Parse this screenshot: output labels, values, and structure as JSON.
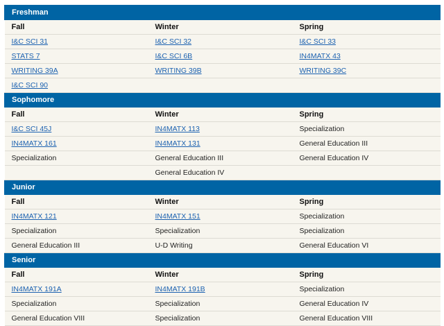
{
  "columns": [
    "Fall",
    "Winter",
    "Spring"
  ],
  "years": [
    {
      "name": "Freshman",
      "rows": [
        [
          {
            "text": "I&C SCI 31",
            "link": true
          },
          {
            "text": "I&C SCI 32",
            "link": true
          },
          {
            "text": "I&C SCI 33",
            "link": true
          }
        ],
        [
          {
            "text": "STATS 7",
            "link": true
          },
          {
            "text": "I&C SCI 6B",
            "link": true
          },
          {
            "text": "IN4MATX 43",
            "link": true
          }
        ],
        [
          {
            "text": "WRITING 39A",
            "link": true
          },
          {
            "text": "WRITING 39B",
            "link": true
          },
          {
            "text": "WRITING 39C",
            "link": true
          }
        ],
        [
          {
            "text": "I&C SCI 90",
            "link": true
          },
          {
            "text": "",
            "link": false
          },
          {
            "text": "",
            "link": false
          }
        ]
      ]
    },
    {
      "name": "Sophomore",
      "rows": [
        [
          {
            "text": "I&C SCI 45J",
            "link": true
          },
          {
            "text": "IN4MATX 113",
            "link": true
          },
          {
            "text": "Specialization",
            "link": false
          }
        ],
        [
          {
            "text": "IN4MATX 161",
            "link": true
          },
          {
            "text": "IN4MATX 131",
            "link": true
          },
          {
            "text": "General Education III",
            "link": false
          }
        ],
        [
          {
            "text": "Specialization",
            "link": false
          },
          {
            "text": "General Education III",
            "link": false
          },
          {
            "text": "General Education IV",
            "link": false
          }
        ],
        [
          {
            "text": "",
            "link": false
          },
          {
            "text": "General Education IV",
            "link": false
          },
          {
            "text": "",
            "link": false
          }
        ]
      ]
    },
    {
      "name": "Junior",
      "rows": [
        [
          {
            "text": "IN4MATX 121",
            "link": true
          },
          {
            "text": "IN4MATX 151",
            "link": true
          },
          {
            "text": "Specialization",
            "link": false
          }
        ],
        [
          {
            "text": "Specialization",
            "link": false
          },
          {
            "text": "Specialization",
            "link": false
          },
          {
            "text": "Specialization",
            "link": false
          }
        ],
        [
          {
            "text": "General Education III",
            "link": false
          },
          {
            "text": "U-D Writing",
            "link": false
          },
          {
            "text": "General Education VI",
            "link": false
          }
        ]
      ]
    },
    {
      "name": "Senior",
      "rows": [
        [
          {
            "text": "IN4MATX 191A",
            "link": true
          },
          {
            "text": "IN4MATX 191B",
            "link": true
          },
          {
            "text": "Specialization",
            "link": false
          }
        ],
        [
          {
            "text": "Specialization",
            "link": false
          },
          {
            "text": "Specialization",
            "link": false
          },
          {
            "text": "General Education IV",
            "link": false
          }
        ],
        [
          {
            "text": "General Education VIII",
            "link": false
          },
          {
            "text": "Specialization",
            "link": false
          },
          {
            "text": "General Education VIII",
            "link": false
          }
        ]
      ]
    }
  ],
  "colors": {
    "header_blue": "#0064a4",
    "row_bg": "#f7f5ee",
    "link": "#1b61b0"
  }
}
